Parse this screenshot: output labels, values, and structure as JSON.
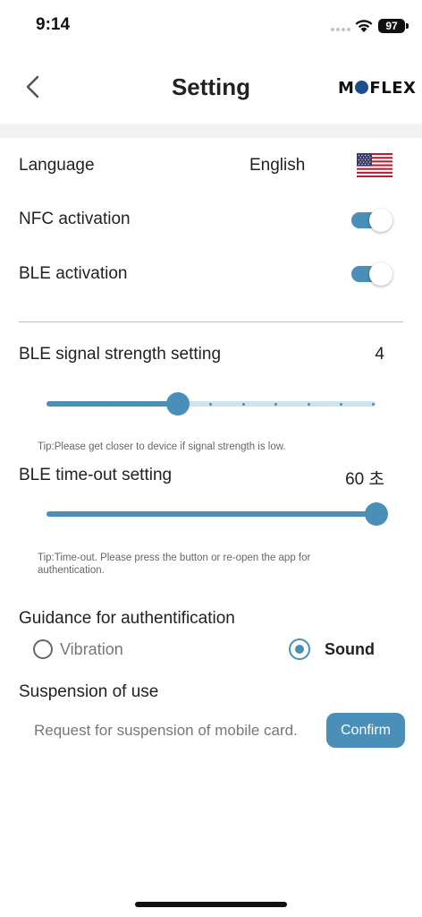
{
  "status_bar": {
    "time": "9:14",
    "battery": "97"
  },
  "header": {
    "title": "Setting",
    "brand": {
      "pre": "M",
      "post": "FLEX"
    }
  },
  "language": {
    "label": "Language",
    "value": "English",
    "flag_icon": "us-flag-icon"
  },
  "nfc": {
    "label": "NFC activation",
    "enabled": true
  },
  "ble": {
    "label": "BLE activation",
    "enabled": true
  },
  "signal_strength": {
    "label": "BLE signal strength setting",
    "value": "4",
    "min": 1,
    "max": 11,
    "current": 5,
    "tip": "Tip:Please get closer to device if signal strength is low."
  },
  "timeout": {
    "label": "BLE time-out setting",
    "value": "60 초",
    "fill_fraction": 1.0,
    "tip": "Tip:Time-out. Please press the button or re-open the app for authentication."
  },
  "guidance": {
    "title": "Guidance for authentification",
    "options": [
      {
        "label": "Vibration",
        "selected": false
      },
      {
        "label": "Sound",
        "selected": true
      }
    ]
  },
  "suspension": {
    "title": "Suspension of use",
    "description": "Request for suspension of mobile card.",
    "button_label": "Confirm"
  },
  "colors": {
    "accent": "#4a8fb7",
    "track_light": "#cfe3ef",
    "divider_band": "#f1f1f2"
  }
}
